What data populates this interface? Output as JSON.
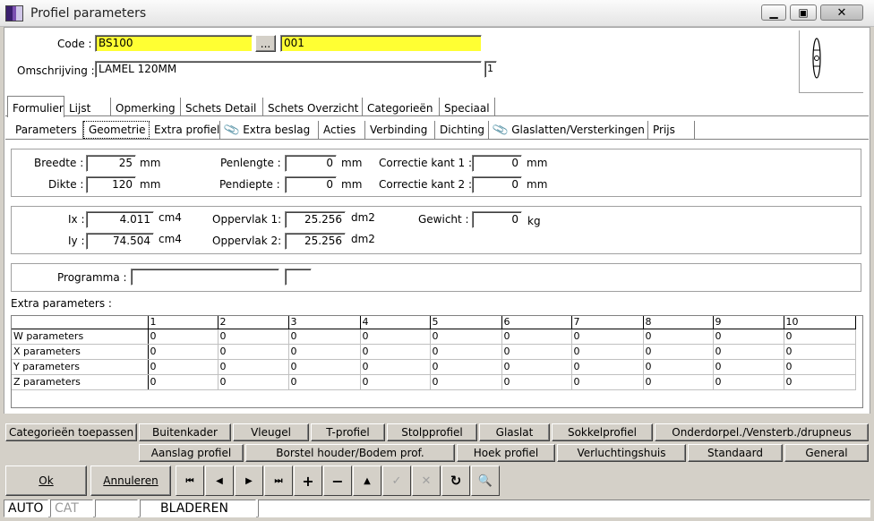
{
  "window": {
    "title": "Profiel parameters"
  },
  "header": {
    "code_label": "Code :",
    "code_value": "BS100",
    "code_browse": "...",
    "code_sub": "001",
    "omschrijving_label": "Omschrijving :",
    "omschrijving_value": "LAMEL 120MM",
    "omschrijving_count": "1"
  },
  "tabs": [
    "Formulier",
    "Lijst",
    "Opmerking",
    "Schets Detail",
    "Schets Overzicht",
    "Categorieën",
    "Speciaal"
  ],
  "subtabs": [
    "Parameters",
    "Geometrie",
    "Extra profiel",
    "Extra beslag",
    "Acties",
    "Verbinding",
    "Dichting",
    "Glaslatten/Versterkingen",
    "Prijs"
  ],
  "geometry": {
    "breedte_label": "Breedte :",
    "breedte_value": "25",
    "breedte_unit": "mm",
    "dikte_label": "Dikte :",
    "dikte_value": "120",
    "dikte_unit": "mm",
    "penlengte_label": "Penlengte :",
    "penlengte_value": "0",
    "penlengte_unit": "mm",
    "pendiepte_label": "Pendiepte :",
    "pendiepte_value": "0",
    "pendiepte_unit": "mm",
    "correctie1_label": "Correctie kant 1 :",
    "correctie1_value": "0",
    "correctie1_unit": "mm",
    "correctie2_label": "Correctie kant 2 :",
    "correctie2_value": "0",
    "correctie2_unit": "mm",
    "ix_label": "Ix :",
    "ix_value": "4.011",
    "ix_unit": "cm4",
    "iy_label": "Iy :",
    "iy_value": "74.504",
    "iy_unit": "cm4",
    "opp1_label": "Oppervlak 1:",
    "opp1_value": "25.256",
    "opp1_unit": "dm2",
    "opp2_label": "Oppervlak 2:",
    "opp2_value": "25.256",
    "opp2_unit": "dm2",
    "gewicht_label": "Gewicht :",
    "gewicht_value": "0",
    "gewicht_unit": "kg",
    "programma_label": "Programma :",
    "programma_value": "",
    "programma_extra": ""
  },
  "extra": {
    "label": "Extra parameters :",
    "columns": [
      "1",
      "2",
      "3",
      "4",
      "5",
      "6",
      "7",
      "8",
      "9",
      "10"
    ],
    "rows": [
      {
        "name": "W parameters",
        "values": [
          "0",
          "0",
          "0",
          "0",
          "0",
          "0",
          "0",
          "0",
          "0",
          "0"
        ]
      },
      {
        "name": "X parameters",
        "values": [
          "0",
          "0",
          "0",
          "0",
          "0",
          "0",
          "0",
          "0",
          "0",
          "0"
        ]
      },
      {
        "name": "Y parameters",
        "values": [
          "0",
          "0",
          "0",
          "0",
          "0",
          "0",
          "0",
          "0",
          "0",
          "0"
        ]
      },
      {
        "name": "Z parameters",
        "values": [
          "0",
          "0",
          "0",
          "0",
          "0",
          "0",
          "0",
          "0",
          "0",
          "0"
        ]
      }
    ]
  },
  "bottom_buttons_row1": [
    "Categorieën toepassen",
    "Buitenkader",
    "Vleugel",
    "T-profiel",
    "Stolpprofiel",
    "Glaslat",
    "Sokkelprofiel",
    "Onderdorpel./Vensterb./drupneus"
  ],
  "bottom_buttons_row2": [
    "Aanslag profiel",
    "Borstel houder/Bodem prof.",
    "Hoek profiel",
    "Verluchtingshuis",
    "Standaard",
    "General"
  ],
  "actions": {
    "ok": "Ok",
    "annuleren": "Annuleren"
  },
  "nav": {
    "first": "⏮",
    "prev": "◀",
    "next": "▶",
    "last": "⏭",
    "add": "+",
    "delete": "−",
    "up": "▲",
    "confirm": "✓",
    "cancel": "✕",
    "refresh": "↻",
    "find": "🔍"
  },
  "status": {
    "mode": "AUTO",
    "cat": "CAT",
    "empty": "",
    "state": "BLADEREN"
  }
}
